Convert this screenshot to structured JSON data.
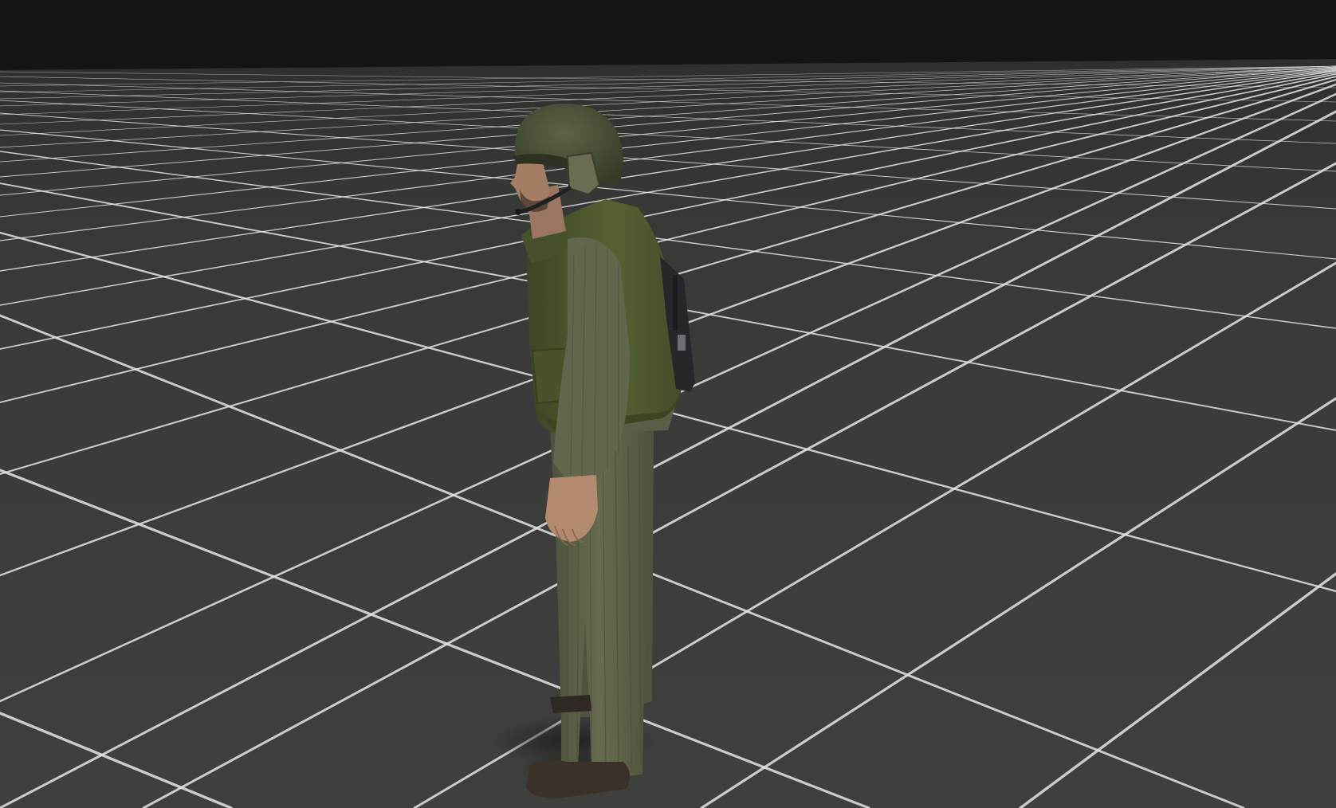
{
  "scene": {
    "view": "model-viewer-3d-viewport",
    "background_color": "#141414",
    "floor_color": "#3b3d3a",
    "grid_line_color": "#e6e6e6",
    "grid_visible": true,
    "model": {
      "subject": "soldier-character-model",
      "pose": "standing-side-profile",
      "parts": [
        "helmet-icon",
        "headset-icon",
        "vest-icon",
        "radio-pouch-icon",
        "uniform-icon",
        "boots-icon"
      ],
      "colors": {
        "helmet": "#4a5238",
        "vest": "#4f5a30",
        "uniform": "#5c6148",
        "skin": "#b48a6e",
        "boots": "#3a3229",
        "radio": "#25272a"
      }
    }
  }
}
